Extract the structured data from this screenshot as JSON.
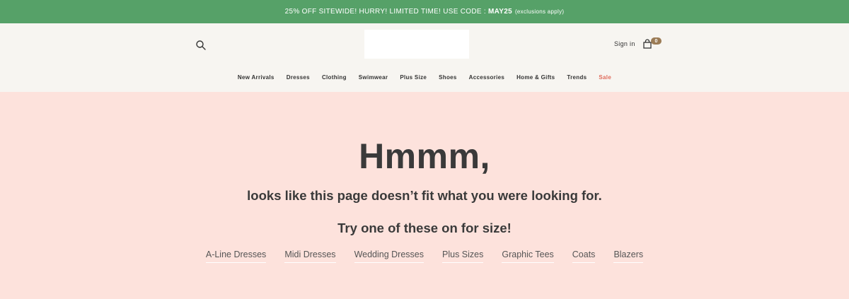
{
  "promo": {
    "text": "25% OFF SITEWIDE! HURRY! LIMITED TIME! USE CODE :",
    "code": "MAY25",
    "note": "(exclusions apply)"
  },
  "header": {
    "signin_label": "Sign in",
    "cart_count": "0",
    "icons": {
      "search": "search-icon",
      "cart": "shopping-bag-icon"
    }
  },
  "nav": {
    "items": [
      {
        "label": "New Arrivals"
      },
      {
        "label": "Dresses"
      },
      {
        "label": "Clothing"
      },
      {
        "label": "Swimwear"
      },
      {
        "label": "Plus Size"
      },
      {
        "label": "Shoes"
      },
      {
        "label": "Accessories"
      },
      {
        "label": "Home & Gifts"
      },
      {
        "label": "Trends"
      },
      {
        "label": "Sale"
      }
    ]
  },
  "main": {
    "headline": "Hmmm,",
    "subheading": "looks like this page doesn’t fit what you were looking for.",
    "try_text": "Try one of these on for size!",
    "links": [
      {
        "label": "A-Line Dresses"
      },
      {
        "label": "Midi Dresses"
      },
      {
        "label": "Wedding Dresses"
      },
      {
        "label": "Plus Sizes"
      },
      {
        "label": "Graphic Tees"
      },
      {
        "label": "Coats"
      },
      {
        "label": "Blazers"
      }
    ]
  },
  "colors": {
    "promo_bg": "#56a168",
    "header_bg": "#f7f5f1",
    "page_bg": "#fde2dc",
    "sale": "#e06a5a",
    "badge": "#9b7b55"
  }
}
